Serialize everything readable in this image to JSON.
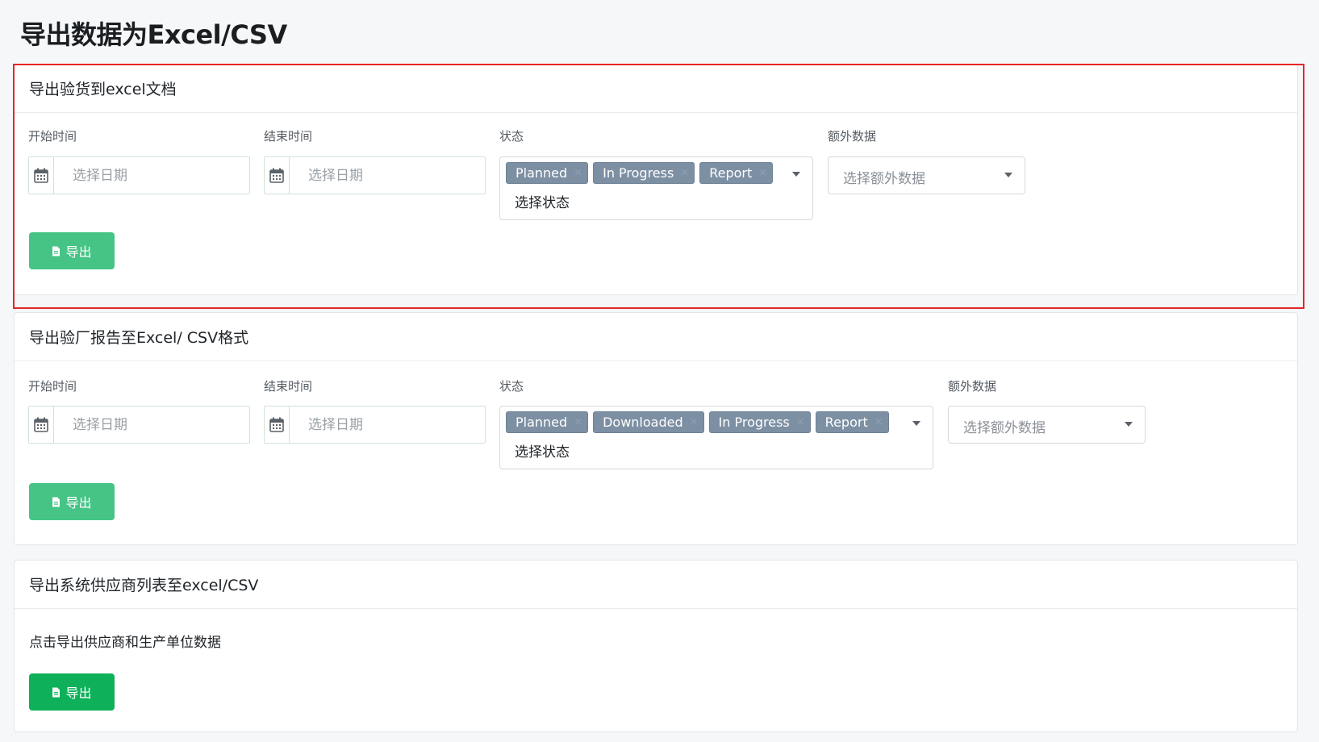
{
  "page": {
    "title": "导出数据为Excel/CSV"
  },
  "sections": [
    {
      "title": "导出验货到excel文档",
      "start_label": "开始时间",
      "end_label": "结束时间",
      "status_label": "状态",
      "extra_label": "额外数据",
      "date_placeholder": "选择日期",
      "status_tags": [
        "Planned",
        "In Progress",
        "Report"
      ],
      "status_placeholder": "选择状态",
      "extra_placeholder": "选择额外数据",
      "export_label": "导出"
    },
    {
      "title": "导出验厂报告至Excel/ CSV格式",
      "start_label": "开始时间",
      "end_label": "结束时间",
      "status_label": "状态",
      "extra_label": "额外数据",
      "date_placeholder": "选择日期",
      "status_tags": [
        "Planned",
        "Downloaded",
        "In Progress",
        "Report"
      ],
      "status_placeholder": "选择状态",
      "extra_placeholder": "选择额外数据",
      "export_label": "导出"
    },
    {
      "title": "导出系统供应商列表至excel/CSV",
      "description": "点击导出供应商和生产单位数据",
      "export_label": "导出"
    }
  ],
  "tag_remove_glyph": "×",
  "colors": {
    "export_button_light": "#45c486",
    "export_button_dark": "#0eb15a",
    "tag_background": "#7d8fa3",
    "highlight_border": "#e4262a"
  },
  "icons": {
    "date_addon": "calendar-icon",
    "export_button": "file-icon",
    "dropdown": "caret-down-icon"
  }
}
